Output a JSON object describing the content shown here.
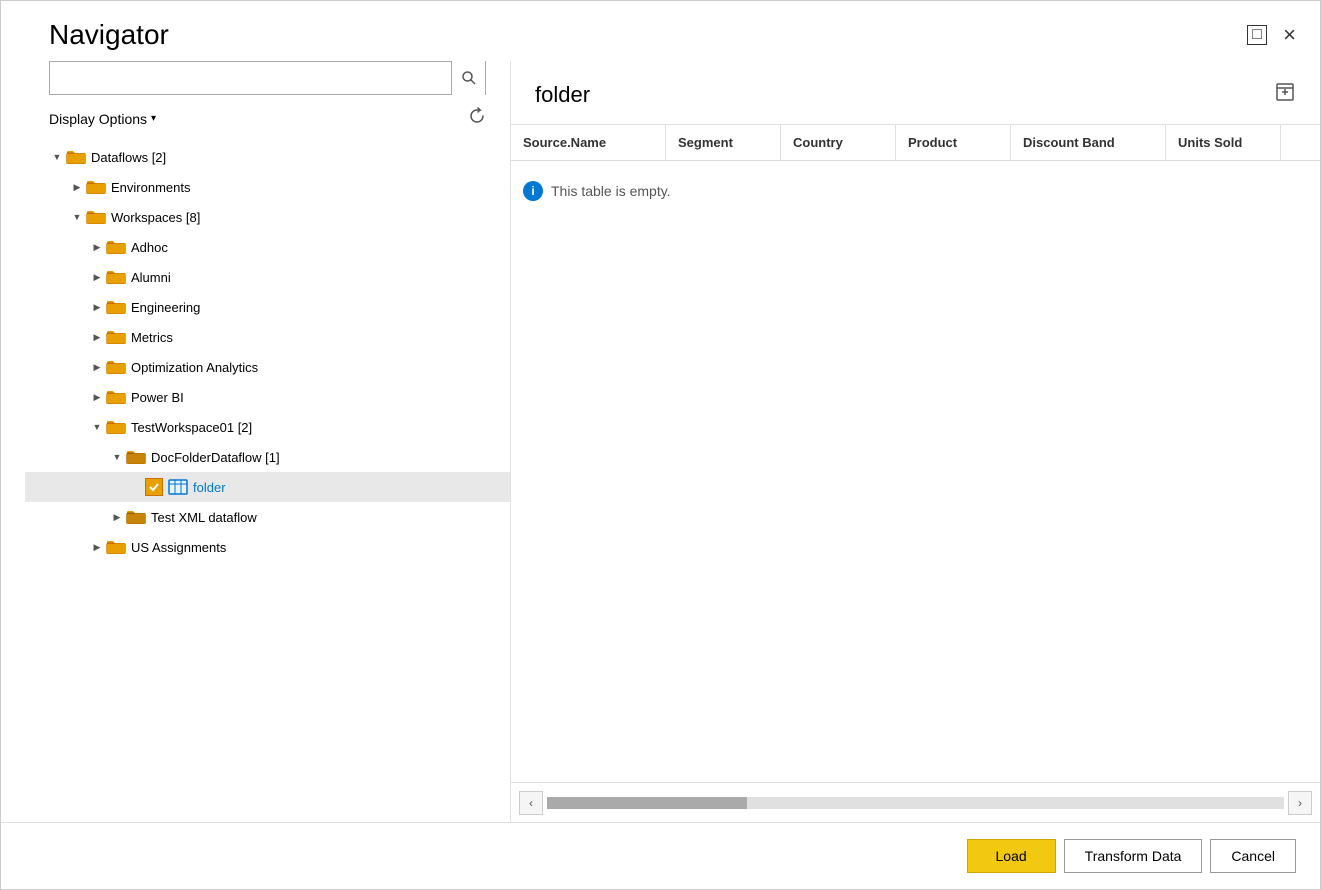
{
  "dialog": {
    "title": "Navigator"
  },
  "titlebar": {
    "maximize_label": "□",
    "close_label": "×"
  },
  "search": {
    "placeholder": ""
  },
  "display_options": {
    "label": "Display Options",
    "arrow": "▾"
  },
  "right_panel": {
    "folder_title": "folder",
    "empty_message": "This table is empty."
  },
  "table_headers": [
    {
      "id": "source-name",
      "label": "Source.Name"
    },
    {
      "id": "segment",
      "label": "Segment"
    },
    {
      "id": "country",
      "label": "Country"
    },
    {
      "id": "product",
      "label": "Product"
    },
    {
      "id": "discount-band",
      "label": "Discount Band"
    },
    {
      "id": "units-sold",
      "label": "Units Sold"
    }
  ],
  "tree": {
    "items": [
      {
        "id": "dataflows",
        "label": "Dataflows [2]",
        "level": 0,
        "chevron": "▼",
        "type": "folder",
        "expanded": true
      },
      {
        "id": "environments",
        "label": "Environments",
        "level": 1,
        "chevron": "▶",
        "type": "folder",
        "expanded": false
      },
      {
        "id": "workspaces",
        "label": "Workspaces [8]",
        "level": 1,
        "chevron": "▼",
        "type": "folder",
        "expanded": true
      },
      {
        "id": "adhoc",
        "label": "Adhoc",
        "level": 2,
        "chevron": "▶",
        "type": "folder",
        "expanded": false
      },
      {
        "id": "alumni",
        "label": "Alumni",
        "level": 2,
        "chevron": "▶",
        "type": "folder",
        "expanded": false
      },
      {
        "id": "engineering",
        "label": "Engineering",
        "level": 2,
        "chevron": "▶",
        "type": "folder",
        "expanded": false
      },
      {
        "id": "metrics",
        "label": "Metrics",
        "level": 2,
        "chevron": "▶",
        "type": "folder",
        "expanded": false
      },
      {
        "id": "optimization-analytics",
        "label": "Optimization Analytics",
        "level": 2,
        "chevron": "▶",
        "type": "folder",
        "expanded": false
      },
      {
        "id": "power-bi",
        "label": "Power BI",
        "level": 2,
        "chevron": "▶",
        "type": "folder",
        "expanded": false
      },
      {
        "id": "testworkspace01",
        "label": "TestWorkspace01 [2]",
        "level": 2,
        "chevron": "▼",
        "type": "folder",
        "expanded": true
      },
      {
        "id": "docfolderdataflow",
        "label": "DocFolderDataflow [1]",
        "level": 3,
        "chevron": "▼",
        "type": "folder-dark",
        "expanded": true
      },
      {
        "id": "folder",
        "label": "folder",
        "level": 4,
        "chevron": "",
        "type": "checked-table",
        "expanded": false,
        "selected": true
      },
      {
        "id": "test-xml-dataflow",
        "label": "Test XML dataflow",
        "level": 3,
        "chevron": "▶",
        "type": "folder-dark",
        "expanded": false
      },
      {
        "id": "us-assignments",
        "label": "US Assignments",
        "level": 2,
        "chevron": "▶",
        "type": "folder",
        "expanded": false
      }
    ]
  },
  "footer": {
    "load_label": "Load",
    "transform_label": "Transform Data",
    "cancel_label": "Cancel"
  }
}
